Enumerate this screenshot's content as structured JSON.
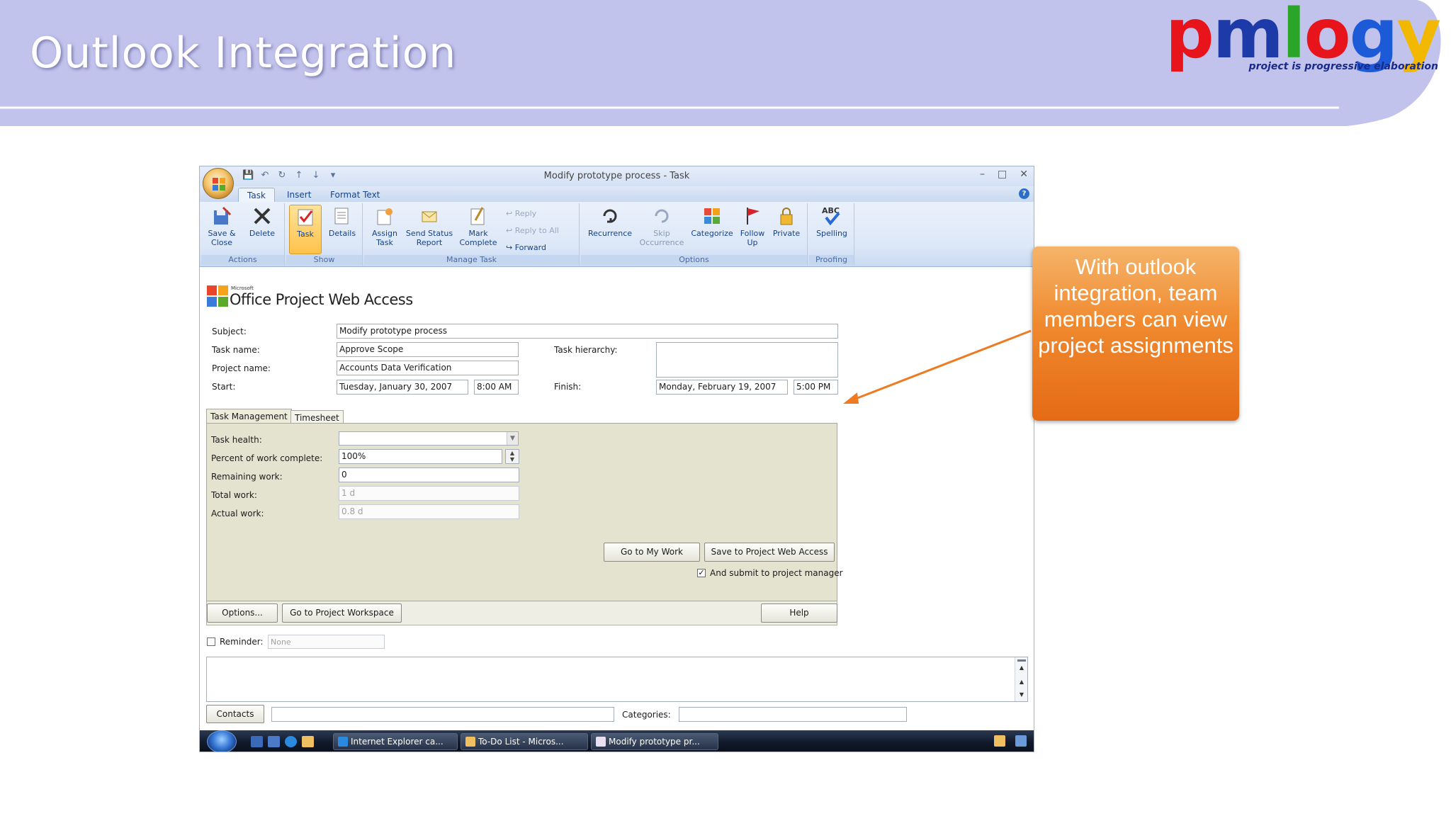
{
  "slide": {
    "title": "Outlook Integration",
    "logo": {
      "letters": [
        "p",
        "m",
        "l",
        "o",
        "g",
        "y"
      ],
      "colors": [
        "#e8141c",
        "#1c3ba8",
        "#2aa52a",
        "#e8141c",
        "#1c5ad8",
        "#f2b800"
      ],
      "tagline": "project is progressive elaboration"
    },
    "callout": "With outlook integration, team members can view project assignments",
    "accent_orange": "#ee7a22",
    "banner_color": "#c2c3ec"
  },
  "window": {
    "title": "Modify prototype process - Task",
    "tabs": [
      "Task",
      "Insert",
      "Format Text"
    ],
    "ribbon": {
      "actions": {
        "label": "Actions",
        "save_close": "Save & Close",
        "delete": "Delete"
      },
      "show": {
        "label": "Show",
        "task": "Task",
        "details": "Details"
      },
      "manage": {
        "label": "Manage Task",
        "assign": "Assign Task",
        "send_status": "Send Status Report",
        "mark_complete": "Mark Complete",
        "reply": "Reply",
        "reply_all": "Reply to All",
        "forward": "Forward"
      },
      "options": {
        "label": "Options",
        "recurrence": "Recurrence",
        "skip": "Skip Occurrence",
        "categorize": "Categorize",
        "follow_up": "Follow Up",
        "private": "Private"
      },
      "proofing": {
        "label": "Proofing",
        "spelling": "Spelling",
        "abc": "ABC"
      }
    }
  },
  "form": {
    "brand_small": "Microsoft",
    "brand": "Office Project Web Access",
    "subject_label": "Subject:",
    "subject": "Modify prototype process",
    "task_name_label": "Task name:",
    "task_name": "Approve Scope",
    "task_hierarchy_label": "Task hierarchy:",
    "project_name_label": "Project name:",
    "project_name": "Accounts Data Verification",
    "start_label": "Start:",
    "start_date": "Tuesday, January 30, 2007",
    "start_time": "8:00 AM",
    "finish_label": "Finish:",
    "finish_date": "Monday, February 19, 2007",
    "finish_time": "5:00 PM",
    "tab_task_management": "Task Management",
    "tab_timesheet": "Timesheet",
    "task_health_label": "Task health:",
    "percent_label": "Percent of work complete:",
    "percent": "100%",
    "remaining_label": "Remaining work:",
    "remaining": "0",
    "total_label": "Total work:",
    "total": "1 d",
    "actual_label": "Actual work:",
    "actual": "0.8 d",
    "go_my_work": "Go to My Work",
    "save_pwa": "Save to Project Web Access",
    "submit_label": "And submit to project manager",
    "options_btn": "Options...",
    "workspace_btn": "Go to Project Workspace",
    "help_btn": "Help",
    "reminder_label": "Reminder:",
    "reminder_value": "None",
    "contacts_btn": "Contacts",
    "categories_label": "Categories:"
  },
  "taskbar": {
    "items": [
      "Internet Explorer ca...",
      "To-Do List - Micros...",
      "Modify prototype pr..."
    ]
  }
}
